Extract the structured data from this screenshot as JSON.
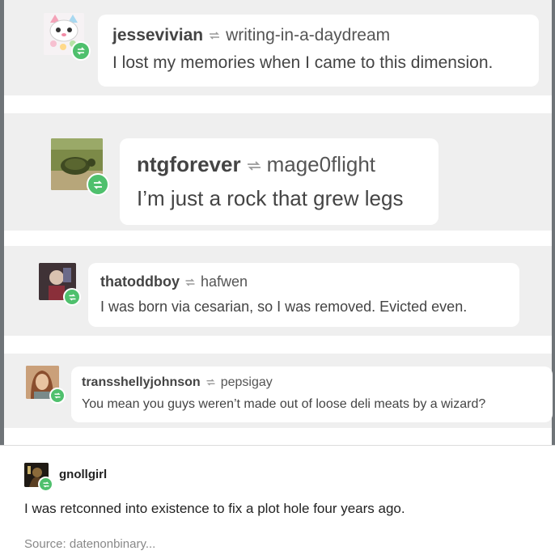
{
  "thread": [
    {
      "username": "jessevivian",
      "reblogged_from": "writing-in-a-daydream",
      "message": "I lost my memories when I came to this dimension.",
      "avatar": "cat-avatar",
      "colors": {
        "avatar_bg": "#f2eef0"
      }
    },
    {
      "username": "ntgforever",
      "reblogged_from": "mage0flight",
      "message": "I’m just a rock that grew legs",
      "avatar": "turtle-avatar",
      "colors": {
        "avatar_bg": "#6a7a3a"
      }
    },
    {
      "username": "thatoddboy",
      "reblogged_from": "hafwen",
      "message": "I was born via cesarian, so I was removed. Evicted even.",
      "avatar": "character-avatar",
      "colors": {
        "avatar_bg": "#4a3a3a"
      }
    },
    {
      "username": "transshellyjohnson",
      "reblogged_from": "pepsigay",
      "message": "You mean you guys weren’t made out of loose deli meats by a wizard?",
      "avatar": "person-avatar",
      "colors": {
        "avatar_bg": "#b98660"
      }
    }
  ],
  "final_post": {
    "username": "gnollgirl",
    "message": "I was retconned into existence to fix a plot hole four years ago.",
    "source": "Source: datenonbinary...",
    "avatar": "dark-avatar"
  },
  "icons": {
    "reblog": "reblog-icon",
    "badge": "reblog-badge-icon"
  },
  "colors": {
    "background": "#efefef",
    "bubble": "#ffffff",
    "badge": "#4fc06d"
  }
}
